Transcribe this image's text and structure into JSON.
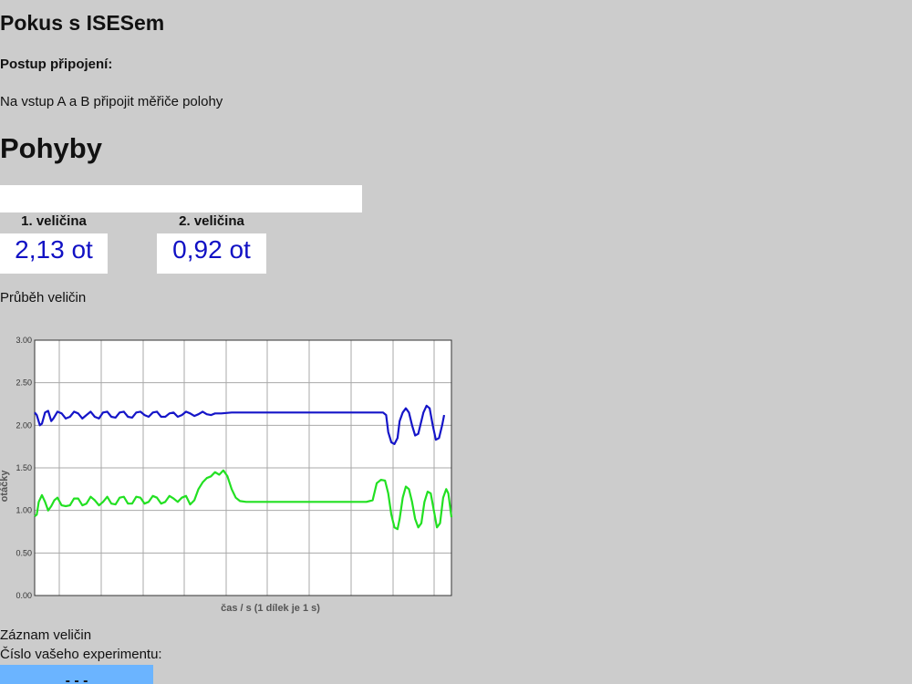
{
  "header": {
    "title": "Pokus s ISESem",
    "subtitle": "Postup připojení:",
    "description": "Na vstup A a B připojit měřiče polohy"
  },
  "section": {
    "title": "Pohyby"
  },
  "quantities": [
    {
      "label": "1. veličina",
      "value": "2,13 ot"
    },
    {
      "label": "2. veličina",
      "value": "0,92 ot"
    }
  ],
  "graph_caption": "Průběh veličin",
  "record_caption": "Záznam veličin",
  "experiment_label": "Číslo vašeho experimentu:",
  "experiment_value": "- - -",
  "colors": {
    "series1": "#1515c8",
    "series2": "#22e022",
    "value_text": "#1111c4",
    "experiment_box": "#6bb4ff"
  },
  "chart_data": {
    "type": "line",
    "xlabel": "čas / s (1 dílek je 1 s)",
    "ylabel": "otáčky",
    "ylim": [
      0,
      3
    ],
    "yticks": [
      "0.00",
      "0.50",
      "1.00",
      "1.50",
      "2.00",
      "2.50",
      "3.00"
    ],
    "grid": true,
    "series": [
      {
        "color": "#1515c8",
        "points": [
          [
            0.0,
            2.15
          ],
          [
            0.1,
            2.12
          ],
          [
            0.25,
            2.0
          ],
          [
            0.35,
            2.02
          ],
          [
            0.5,
            2.15
          ],
          [
            0.65,
            2.17
          ],
          [
            0.8,
            2.05
          ],
          [
            0.9,
            2.08
          ],
          [
            1.1,
            2.16
          ],
          [
            1.3,
            2.14
          ],
          [
            1.5,
            2.08
          ],
          [
            1.7,
            2.1
          ],
          [
            1.9,
            2.16
          ],
          [
            2.1,
            2.14
          ],
          [
            2.3,
            2.08
          ],
          [
            2.5,
            2.12
          ],
          [
            2.7,
            2.16
          ],
          [
            2.9,
            2.1
          ],
          [
            3.1,
            2.08
          ],
          [
            3.3,
            2.15
          ],
          [
            3.5,
            2.16
          ],
          [
            3.7,
            2.1
          ],
          [
            3.9,
            2.09
          ],
          [
            4.1,
            2.15
          ],
          [
            4.3,
            2.16
          ],
          [
            4.5,
            2.1
          ],
          [
            4.7,
            2.09
          ],
          [
            4.9,
            2.15
          ],
          [
            5.1,
            2.16
          ],
          [
            5.3,
            2.12
          ],
          [
            5.5,
            2.1
          ],
          [
            5.7,
            2.15
          ],
          [
            5.9,
            2.16
          ],
          [
            6.1,
            2.1
          ],
          [
            6.3,
            2.1
          ],
          [
            6.5,
            2.14
          ],
          [
            6.7,
            2.15
          ],
          [
            6.9,
            2.1
          ],
          [
            7.1,
            2.12
          ],
          [
            7.3,
            2.16
          ],
          [
            7.5,
            2.14
          ],
          [
            7.7,
            2.11
          ],
          [
            7.9,
            2.13
          ],
          [
            8.1,
            2.16
          ],
          [
            8.3,
            2.13
          ],
          [
            8.5,
            2.12
          ],
          [
            8.7,
            2.14
          ],
          [
            9.0,
            2.14
          ],
          [
            9.5,
            2.15
          ],
          [
            10.0,
            2.15
          ],
          [
            11.0,
            2.15
          ],
          [
            12.0,
            2.15
          ],
          [
            13.0,
            2.15
          ],
          [
            14.0,
            2.15
          ],
          [
            15.0,
            2.15
          ],
          [
            16.0,
            2.15
          ],
          [
            16.8,
            2.15
          ],
          [
            16.95,
            2.12
          ],
          [
            17.05,
            1.92
          ],
          [
            17.2,
            1.8
          ],
          [
            17.35,
            1.78
          ],
          [
            17.5,
            1.85
          ],
          [
            17.6,
            2.05
          ],
          [
            17.75,
            2.15
          ],
          [
            17.9,
            2.2
          ],
          [
            18.05,
            2.15
          ],
          [
            18.2,
            2.0
          ],
          [
            18.35,
            1.88
          ],
          [
            18.5,
            1.9
          ],
          [
            18.6,
            2.0
          ],
          [
            18.75,
            2.15
          ],
          [
            18.9,
            2.23
          ],
          [
            19.05,
            2.2
          ],
          [
            19.2,
            2.0
          ],
          [
            19.35,
            1.83
          ],
          [
            19.5,
            1.85
          ],
          [
            19.65,
            2.0
          ],
          [
            19.75,
            2.12
          ]
        ]
      },
      {
        "color": "#22e022",
        "points": [
          [
            0.0,
            0.93
          ],
          [
            0.1,
            0.95
          ],
          [
            0.2,
            1.1
          ],
          [
            0.35,
            1.18
          ],
          [
            0.5,
            1.1
          ],
          [
            0.65,
            1.0
          ],
          [
            0.8,
            1.05
          ],
          [
            0.95,
            1.12
          ],
          [
            1.1,
            1.15
          ],
          [
            1.3,
            1.06
          ],
          [
            1.5,
            1.05
          ],
          [
            1.7,
            1.06
          ],
          [
            1.9,
            1.14
          ],
          [
            2.1,
            1.14
          ],
          [
            2.3,
            1.06
          ],
          [
            2.5,
            1.08
          ],
          [
            2.7,
            1.16
          ],
          [
            2.9,
            1.12
          ],
          [
            3.1,
            1.06
          ],
          [
            3.3,
            1.1
          ],
          [
            3.5,
            1.16
          ],
          [
            3.7,
            1.08
          ],
          [
            3.9,
            1.07
          ],
          [
            4.1,
            1.15
          ],
          [
            4.3,
            1.16
          ],
          [
            4.5,
            1.08
          ],
          [
            4.7,
            1.08
          ],
          [
            4.9,
            1.16
          ],
          [
            5.1,
            1.15
          ],
          [
            5.3,
            1.08
          ],
          [
            5.5,
            1.1
          ],
          [
            5.7,
            1.17
          ],
          [
            5.9,
            1.15
          ],
          [
            6.1,
            1.08
          ],
          [
            6.3,
            1.1
          ],
          [
            6.5,
            1.17
          ],
          [
            6.7,
            1.14
          ],
          [
            6.9,
            1.1
          ],
          [
            7.1,
            1.15
          ],
          [
            7.3,
            1.17
          ],
          [
            7.5,
            1.07
          ],
          [
            7.7,
            1.12
          ],
          [
            7.9,
            1.25
          ],
          [
            8.1,
            1.33
          ],
          [
            8.3,
            1.38
          ],
          [
            8.5,
            1.4
          ],
          [
            8.7,
            1.45
          ],
          [
            8.9,
            1.42
          ],
          [
            9.1,
            1.47
          ],
          [
            9.3,
            1.4
          ],
          [
            9.5,
            1.25
          ],
          [
            9.7,
            1.15
          ],
          [
            9.9,
            1.11
          ],
          [
            10.2,
            1.1
          ],
          [
            11.0,
            1.1
          ],
          [
            12.0,
            1.1
          ],
          [
            13.0,
            1.1
          ],
          [
            14.0,
            1.1
          ],
          [
            15.0,
            1.1
          ],
          [
            16.0,
            1.1
          ],
          [
            16.3,
            1.12
          ],
          [
            16.5,
            1.32
          ],
          [
            16.7,
            1.36
          ],
          [
            16.9,
            1.35
          ],
          [
            17.05,
            1.2
          ],
          [
            17.2,
            0.95
          ],
          [
            17.35,
            0.8
          ],
          [
            17.5,
            0.78
          ],
          [
            17.6,
            0.9
          ],
          [
            17.75,
            1.15
          ],
          [
            17.9,
            1.28
          ],
          [
            18.05,
            1.25
          ],
          [
            18.2,
            1.1
          ],
          [
            18.35,
            0.9
          ],
          [
            18.5,
            0.8
          ],
          [
            18.65,
            0.85
          ],
          [
            18.8,
            1.1
          ],
          [
            18.95,
            1.22
          ],
          [
            19.1,
            1.2
          ],
          [
            19.25,
            1.0
          ],
          [
            19.4,
            0.8
          ],
          [
            19.55,
            0.85
          ],
          [
            19.7,
            1.15
          ],
          [
            19.85,
            1.25
          ],
          [
            19.95,
            1.2
          ],
          [
            20.1,
            0.92
          ]
        ]
      }
    ]
  }
}
